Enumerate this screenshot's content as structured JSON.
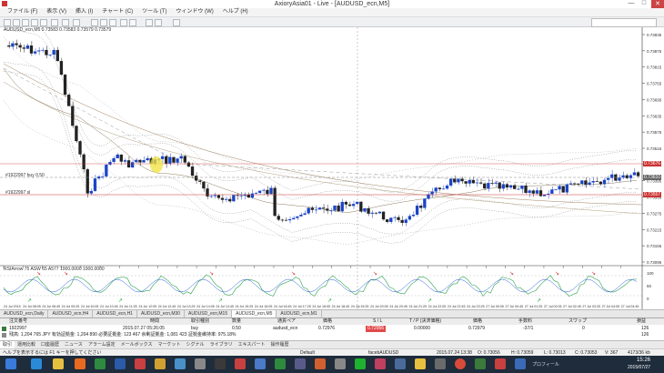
{
  "window": {
    "title": "AxioryAsia01 - Live - [AUDUSD_ecn,M5]",
    "min": "—",
    "max": "□",
    "close": "✕"
  },
  "menu": [
    "ファイル (F)",
    "表示 (V)",
    "挿入 (I)",
    "チャート (C)",
    "ツール (T)",
    "ウィンドウ (W)",
    "ヘルプ (H)"
  ],
  "chart": {
    "symbol_info": "AUDUSD_ecn,M5  0.73583 0.73583 0.73579 0.73579",
    "line_labels": {
      "upper": "#1922997 buy 0.50",
      "lower": "#1922997 sl"
    },
    "price_ticks": [
      "0.73935",
      "0.73875",
      "0.73815",
      "0.73755",
      "0.73695",
      "0.73635",
      "0.73575",
      "0.73515",
      "0.73455",
      "0.73395",
      "0.73335",
      "0.73275",
      "0.73215",
      "0.73155",
      "0.73095"
    ],
    "tag_prices": {
      "upper": "0.73676",
      "mid": "0.73610",
      "lower": "0.73557"
    },
    "time_ticks": [
      "24 Jul 2015",
      "24 Jul 08:05",
      "24 Jul 08:45",
      "24 Jul 09:25",
      "24 Jul 10:05",
      "24 Jul 10:45",
      "24 Jul 11:25",
      "24 Jul 12:05",
      "24 Jul 12:45",
      "24 Jul 13:25",
      "24 Jul 14:05",
      "24 Jul 14:45",
      "24 Jul 15:25",
      "24 Jul 16:05",
      "24 Jul 16:45",
      "24 Jul 17:25",
      "24 Jul 18:05",
      "24 Jul 18:45",
      "24 Jul 19:25",
      "24 Jul 20:05",
      "24 Jul 20:45",
      "24 Jul 21:25",
      "24 Jul 22:05",
      "24 Jul 22:45",
      "24 Jul 23:25",
      "27 Jul 00:05",
      "27 Jul 00:45",
      "27 Jul 01:25",
      "27 Jul 02:05",
      "27 Jul 02:45",
      "27 Jul 03:25",
      "27 Jul 04:05",
      "27 Jul 04:45"
    ],
    "indicator_label": "RSIArrow 75 ASW 65 A577 1000.0000 1000.0000",
    "indicator_ticks": [
      "100",
      "50",
      "0"
    ]
  },
  "chart_tabs": [
    "AUDUSD_ecn,Daily",
    "AUDUSD_ecn,H4",
    "AUDUSD_ecn,H1",
    "AUDUSD_ecn,M30",
    "AUDUSD_ecn,M15",
    "AUDUSD_ecn,M5",
    "AUDUSD_ecn,M1"
  ],
  "orders": {
    "headers": [
      "注文番号",
      "時間",
      "取引種別",
      "数量",
      "通貨ペア",
      "価格",
      "S / L",
      "T / P (決済価格)",
      "価格",
      "手数料",
      "スワップ",
      "損益"
    ],
    "row": [
      "1922997",
      "2015.07.27 05:26:05",
      "buy",
      "0.50",
      "audusd_ecn",
      "0.72976",
      "0.72956",
      "0.00000",
      "0.72979",
      "-37/1",
      "0",
      "126"
    ],
    "balance": "残高: 1,204 765 JPY  有効証拠金: 1,204 890  必要証拠金: 123 467  余剰証拠金: 1,081 423  証拠金維持率: 975.18%",
    "balance_pl": "126"
  },
  "terminal_tabs": [
    "取引",
    "運用比較",
    "口座履歴",
    "ニュース",
    "アラーム設定",
    "メールボックス",
    "マーケット",
    "シグナル",
    "ライブラリ",
    "エキスパート",
    "操作履歴"
  ],
  "status": {
    "help": "ヘルプを表示するには F1 キーを押してください",
    "profile": "Default",
    "symbol": "facebAUDUSD",
    "time": "2015.07.24 13:38",
    "open": "O: 0.73056",
    "high": "H: 0.73059",
    "low": "L: 0.73013",
    "close": "C: 0.73053",
    "vol": "V: 367",
    "conn": "4173/36 kb"
  },
  "taskbar": {
    "time": "15:26",
    "date": "2015/07/27",
    "label": "プロフィール"
  },
  "colors": {
    "candle_up": "#1a44c8",
    "candle_down": "#222222",
    "highlight": "#f2e23a",
    "sl_line": "#cc3333",
    "entry_line": "#888888",
    "taskbar": "#1e2c3c"
  }
}
